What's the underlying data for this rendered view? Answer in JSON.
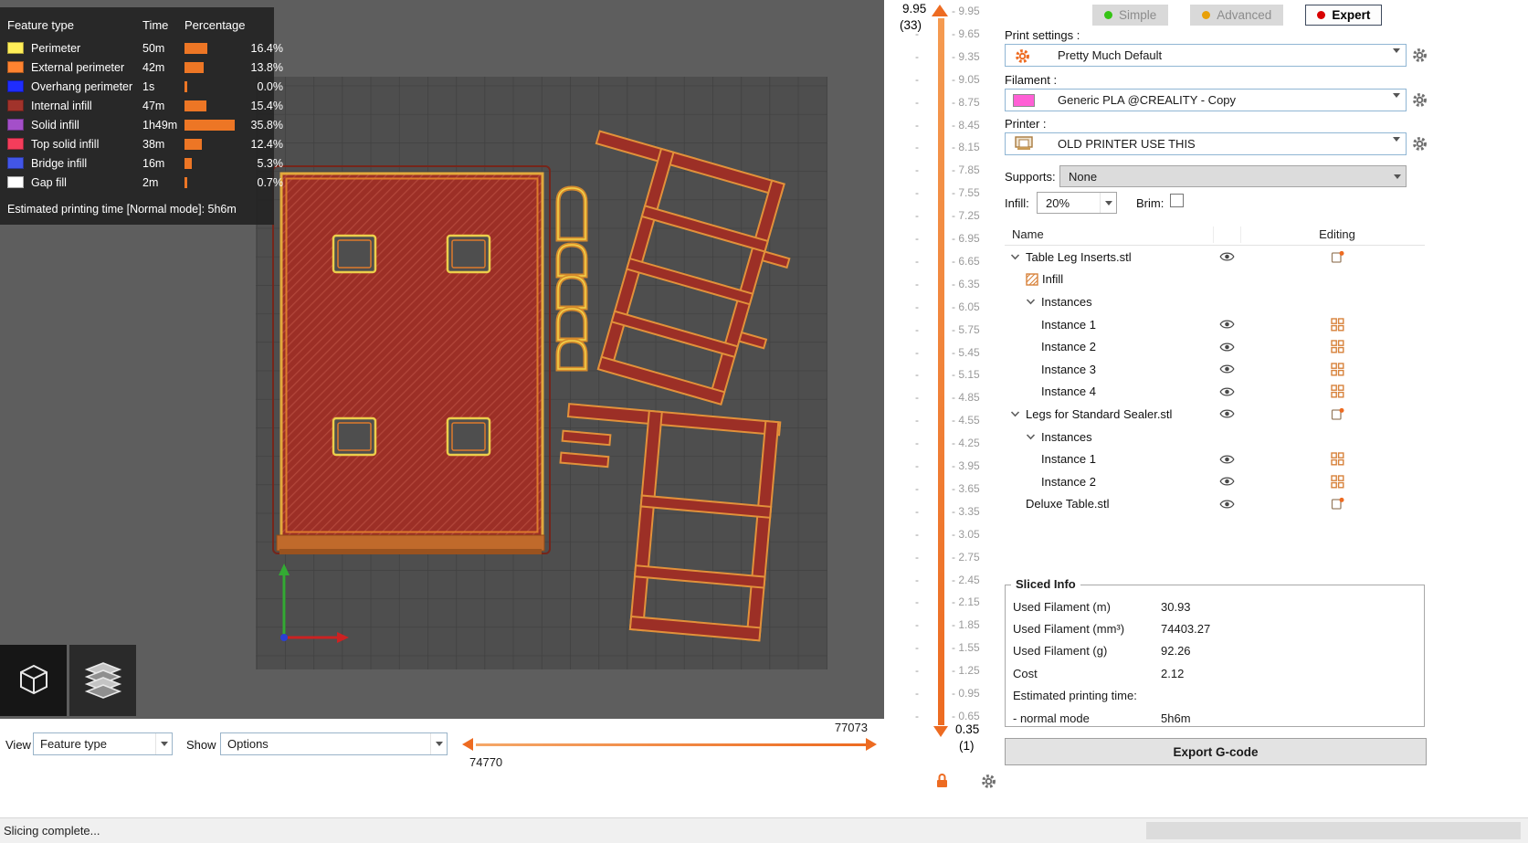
{
  "app": {
    "status_text": "Slicing complete...",
    "accent_orange": "#ED6B21"
  },
  "legend": {
    "header": {
      "feature": "Feature type",
      "time": "Time",
      "percentage": "Percentage"
    },
    "rows": [
      {
        "label": "Perimeter",
        "color": "#FFEE58",
        "time": "50m",
        "percent": "16.4%",
        "value": 16.4
      },
      {
        "label": "External perimeter",
        "color": "#FF8330",
        "time": "42m",
        "percent": "13.8%",
        "value": 13.8
      },
      {
        "label": "Overhang perimeter",
        "color": "#1F2DFF",
        "time": "1s",
        "percent": "0.0%",
        "value": 0.0
      },
      {
        "label": "Internal infill",
        "color": "#A1332B",
        "time": "47m",
        "percent": "15.4%",
        "value": 15.4
      },
      {
        "label": "Solid infill",
        "color": "#A44FC9",
        "time": "1h49m",
        "percent": "35.8%",
        "value": 35.8
      },
      {
        "label": "Top solid infill",
        "color": "#F43D5B",
        "time": "38m",
        "percent": "12.4%",
        "value": 12.4
      },
      {
        "label": "Bridge infill",
        "color": "#4256E8",
        "time": "16m",
        "percent": "5.3%",
        "value": 5.3
      },
      {
        "label": "Gap fill",
        "color": "#FFFFFF",
        "time": "2m",
        "percent": "0.7%",
        "value": 0.7
      }
    ],
    "footer": "Estimated printing time [Normal mode]: 5h6m"
  },
  "view_bar": {
    "view_label": "View",
    "view_value": "Feature type",
    "show_label": "Show",
    "show_value": "Options",
    "range_max": "77073",
    "range_min": "74770"
  },
  "layer_slider": {
    "top_value": "9.95",
    "top_layer": "(33)",
    "bottom_value": "0.35",
    "bottom_layer": "(1)",
    "ticks": [
      "9.95",
      "9.65",
      "9.35",
      "9.05",
      "8.75",
      "8.45",
      "8.15",
      "7.85",
      "7.55",
      "7.25",
      "6.95",
      "6.65",
      "6.35",
      "6.05",
      "5.75",
      "5.45",
      "5.15",
      "4.85",
      "4.55",
      "4.25",
      "3.95",
      "3.65",
      "3.35",
      "3.05",
      "2.75",
      "2.45",
      "2.15",
      "1.85",
      "1.55",
      "1.25",
      "0.95",
      "0.65"
    ]
  },
  "modes": {
    "simple": {
      "label": "Simple",
      "color": "#35C415"
    },
    "advanced": {
      "label": "Advanced",
      "color": "#E8A008"
    },
    "expert": {
      "label": "Expert",
      "color": "#D80000"
    }
  },
  "settings": {
    "print_label": "Print settings :",
    "print_value": "Pretty Much Default",
    "filament_label": "Filament :",
    "filament_value": "Generic PLA @CREALITY - Copy",
    "filament_color": "#FF5FD5",
    "printer_label": "Printer :",
    "printer_value": "OLD PRINTER USE THIS",
    "supports_label": "Supports:",
    "supports_value": "None",
    "infill_label": "Infill:",
    "infill_value": "20%",
    "brim_label": "Brim:",
    "brim_checked": false
  },
  "object_list": {
    "name_header": "Name",
    "editing_header": "Editing",
    "rows": [
      {
        "label": "Table Leg Inserts.stl",
        "indent": 0,
        "expander": true,
        "icon": "",
        "eye": true,
        "edit": "object"
      },
      {
        "label": "Infill",
        "indent": 1,
        "expander": false,
        "icon": "infill",
        "eye": false,
        "edit": ""
      },
      {
        "label": "Instances",
        "indent": 1,
        "expander": true,
        "icon": "",
        "eye": false,
        "edit": ""
      },
      {
        "label": "Instance 1",
        "indent": 2,
        "expander": false,
        "icon": "",
        "eye": true,
        "edit": "grid"
      },
      {
        "label": "Instance 2",
        "indent": 2,
        "expander": false,
        "icon": "",
        "eye": true,
        "edit": "grid"
      },
      {
        "label": "Instance 3",
        "indent": 2,
        "expander": false,
        "icon": "",
        "eye": true,
        "edit": "grid"
      },
      {
        "label": "Instance 4",
        "indent": 2,
        "expander": false,
        "icon": "",
        "eye": true,
        "edit": "grid"
      },
      {
        "label": "Legs for Standard Sealer.stl",
        "indent": 0,
        "expander": true,
        "icon": "",
        "eye": true,
        "edit": "object"
      },
      {
        "label": "Instances",
        "indent": 1,
        "expander": true,
        "icon": "",
        "eye": false,
        "edit": ""
      },
      {
        "label": "Instance 1",
        "indent": 2,
        "expander": false,
        "icon": "",
        "eye": true,
        "edit": "grid"
      },
      {
        "label": "Instance 2",
        "indent": 2,
        "expander": false,
        "icon": "",
        "eye": true,
        "edit": "grid"
      },
      {
        "label": "Deluxe Table.stl",
        "indent": 0,
        "expander": false,
        "icon": "",
        "eye": true,
        "edit": "object"
      }
    ]
  },
  "sliced_info": {
    "title": "Sliced Info",
    "rows": [
      {
        "label": "Used Filament (m)",
        "value": "30.93"
      },
      {
        "label": "Used Filament (mm³)",
        "value": "74403.27"
      },
      {
        "label": "Used Filament (g)",
        "value": "92.26"
      },
      {
        "label": "Cost",
        "value": "2.12"
      },
      {
        "label": "Estimated printing time:",
        "value": ""
      },
      {
        "label": " - normal mode",
        "value": "5h6m"
      }
    ]
  },
  "export_button": "Export G-code"
}
